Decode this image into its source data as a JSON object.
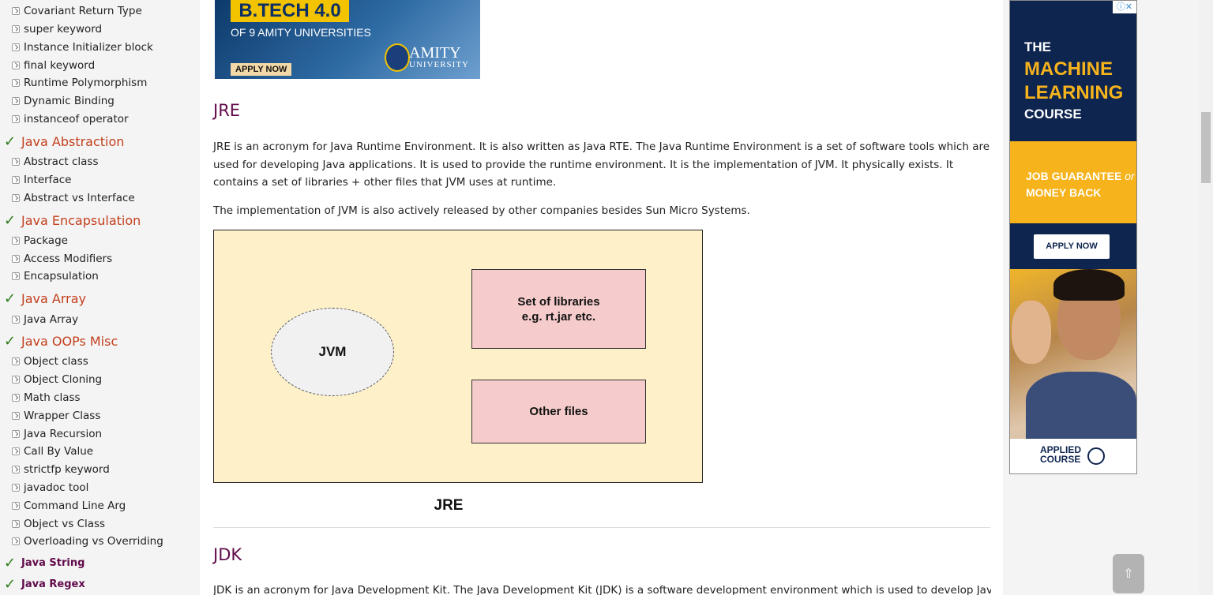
{
  "sidebar": {
    "items": [
      {
        "kind": "item",
        "label": "Covariant Return Type"
      },
      {
        "kind": "item",
        "label": "super keyword"
      },
      {
        "kind": "item",
        "label": "Instance Initializer block"
      },
      {
        "kind": "item",
        "label": "final keyword"
      },
      {
        "kind": "item",
        "label": "Runtime Polymorphism"
      },
      {
        "kind": "item",
        "label": "Dynamic Binding"
      },
      {
        "kind": "item",
        "label": "instanceof operator"
      },
      {
        "kind": "head",
        "label": "Java Abstraction"
      },
      {
        "kind": "item",
        "label": "Abstract class"
      },
      {
        "kind": "item",
        "label": "Interface"
      },
      {
        "kind": "item",
        "label": "Abstract vs Interface"
      },
      {
        "kind": "head",
        "label": "Java Encapsulation"
      },
      {
        "kind": "item",
        "label": "Package"
      },
      {
        "kind": "item",
        "label": "Access Modifiers"
      },
      {
        "kind": "item",
        "label": "Encapsulation"
      },
      {
        "kind": "head",
        "label": "Java Array"
      },
      {
        "kind": "item",
        "label": "Java Array"
      },
      {
        "kind": "head",
        "label": "Java OOPs Misc"
      },
      {
        "kind": "item",
        "label": "Object class"
      },
      {
        "kind": "item",
        "label": "Object Cloning"
      },
      {
        "kind": "item",
        "label": "Math class"
      },
      {
        "kind": "item",
        "label": "Wrapper Class"
      },
      {
        "kind": "item",
        "label": "Java Recursion"
      },
      {
        "kind": "item",
        "label": "Call By Value"
      },
      {
        "kind": "item",
        "label": "strictfp keyword"
      },
      {
        "kind": "item",
        "label": "javadoc tool"
      },
      {
        "kind": "item",
        "label": "Command Line Arg"
      },
      {
        "kind": "item",
        "label": "Object vs Class"
      },
      {
        "kind": "item",
        "label": "Overloading vs Overriding"
      },
      {
        "kind": "head-small",
        "label": "Java String"
      },
      {
        "kind": "head-small",
        "label": "Java Regex"
      }
    ]
  },
  "banner": {
    "headline": "B.TECH 4.0",
    "subline": "OF 9 AMITY UNIVERSITIES",
    "apply": "APPLY NOW",
    "brand": "AMITY",
    "brand_sub": "UNIVERSITY"
  },
  "content": {
    "jre_heading": "JRE",
    "jre_p1": "JRE is an acronym for Java Runtime Environment. It is also written as Java RTE. The Java Runtime Environment is a set of software tools which are used for developing Java applications. It is used to provide the runtime environment. It is the implementation of JVM. It physically exists. It contains a set of libraries + other files that JVM uses at runtime.",
    "jre_p2": "The implementation of JVM is also actively released by other companies besides Sun Micro Systems.",
    "diagram": {
      "jvm": "JVM",
      "libraries_line1": "Set of libraries",
      "libraries_line2": "e.g. rt.jar etc.",
      "other": "Other files",
      "caption": "JRE"
    },
    "jdk_heading": "JDK",
    "jdk_p1": "JDK is an acronym for Java Development Kit. The Java Development Kit (JDK) is a software development environment which is used to develop Java"
  },
  "ad": {
    "close_glyph": "ⓘ✕",
    "the": "THE",
    "machine": "MACHINE",
    "learning": "LEARNING",
    "course": "COURSE",
    "job_guarantee": "JOB GUARANTEE",
    "or": "or",
    "money_back": "MONEY BACK",
    "apply": "APPLY NOW",
    "applied": "APPLIED",
    "course2": "COURSE"
  },
  "scroll_top": "⇧"
}
